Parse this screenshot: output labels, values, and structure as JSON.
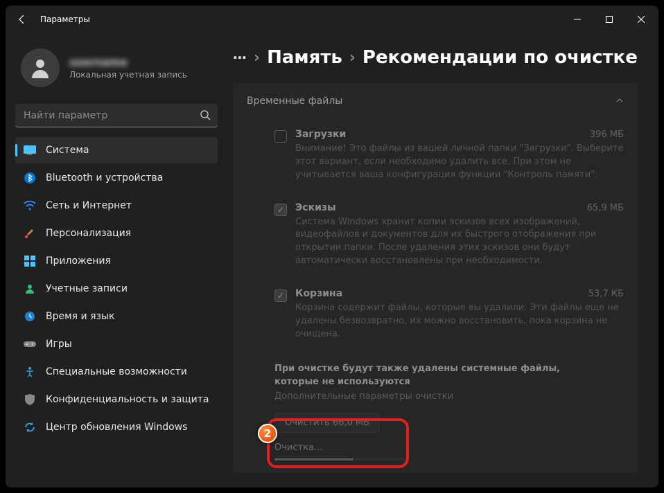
{
  "titlebar": {
    "title": "Параметры"
  },
  "profile": {
    "name": "username",
    "sub": "Локальная учетная запись"
  },
  "search": {
    "placeholder": "Найти параметр"
  },
  "nav": [
    {
      "id": "system",
      "label": "Система",
      "active": true
    },
    {
      "id": "bluetooth",
      "label": "Bluetooth и устройства"
    },
    {
      "id": "network",
      "label": "Сеть и Интернет"
    },
    {
      "id": "personalization",
      "label": "Персонализация"
    },
    {
      "id": "apps",
      "label": "Приложения"
    },
    {
      "id": "accounts",
      "label": "Учетные записи"
    },
    {
      "id": "time",
      "label": "Время и язык"
    },
    {
      "id": "games",
      "label": "Игры"
    },
    {
      "id": "accessibility",
      "label": "Специальные возможности"
    },
    {
      "id": "privacy",
      "label": "Конфиденциальность и защита"
    },
    {
      "id": "update",
      "label": "Центр обновления Windows"
    }
  ],
  "breadcrumb": {
    "dots": "⋯",
    "storage": "Память",
    "current": "Рекомендации по очистке"
  },
  "panel": {
    "title": "Временные файлы"
  },
  "items": [
    {
      "title": "Загрузки",
      "size": "396 МБ",
      "checked": false,
      "desc": "Внимание! Это файлы из вашей личной папки \"Загрузки\". Выберите этот вариант, если необходимо удалить все. При этом не учитывается ваша конфигурация функции \"Контроль памяти\"."
    },
    {
      "title": "Эскизы",
      "size": "65,9 МБ",
      "checked": true,
      "desc": "Система Windows хранит копии эскизов всех изображений, видеофайлов и документов для их быстрого отображения при открытии папки. После удаления этих эскизов они будут автоматически восстановлены при необходимости."
    },
    {
      "title": "Корзина",
      "size": "53,7 КБ",
      "checked": true,
      "desc": "Корзина содержит файлы, которые вы удалили. Эти файлы еще не удалены безвозвратно, их можно восстановить, пока корзина не очищена."
    }
  ],
  "footer": {
    "note": "При очистке будут также удалены системные файлы, которые не используются",
    "advanced": "Дополнительные параметры очистки",
    "clean_button": "Очистить 66,0 МБ",
    "progress_label": "Очистка..."
  },
  "colors": {
    "accent": "#4cc2ff",
    "highlight": "#e02020"
  }
}
